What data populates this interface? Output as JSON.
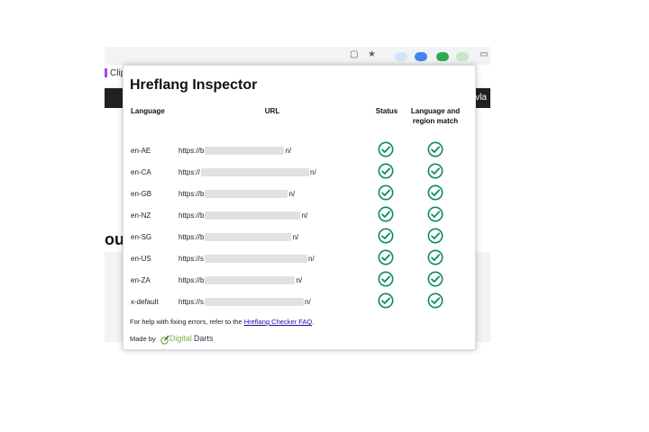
{
  "background": {
    "tab_label": "Clip",
    "darkbar_text": "vla",
    "heading_fragment": "ou"
  },
  "popup": {
    "title": "Hreflang Inspector",
    "columns": {
      "language": "Language",
      "url": "URL",
      "status": "Status",
      "match": "Language and region match"
    },
    "rows": [
      {
        "language": "en-AE",
        "url_prefix": "https://b",
        "url_suffix": "n/"
      },
      {
        "language": "en-CA",
        "url_prefix": "https://",
        "url_suffix": "n/"
      },
      {
        "language": "en-GB",
        "url_prefix": "https://b",
        "url_suffix": "n/"
      },
      {
        "language": "en-NZ",
        "url_prefix": "https://b",
        "url_suffix": "n/"
      },
      {
        "language": "en-SG",
        "url_prefix": "https://b",
        "url_suffix": "n/"
      },
      {
        "language": "en-US",
        "url_prefix": "https://s",
        "url_suffix": "n/"
      },
      {
        "language": "en-ZA",
        "url_prefix": "https://b",
        "url_suffix": "n/"
      },
      {
        "language": "x-default",
        "url_prefix": "https://s",
        "url_suffix": "n/"
      }
    ],
    "footer": {
      "help_prefix": "For help with fixing errors, refer to the ",
      "help_link": "Hreflang Checker FAQ",
      "help_suffix": ".",
      "made_by": "Made by",
      "brand_digital": "Digital",
      "brand_darts": "Darts"
    }
  },
  "colors": {
    "check_green": "#0b8a5f",
    "link_blue": "#1a0dab",
    "dark_bar": "#202124"
  },
  "icons": [
    "status-check-icon",
    "match-check-icon",
    "digital-darts-logo-icon"
  ]
}
